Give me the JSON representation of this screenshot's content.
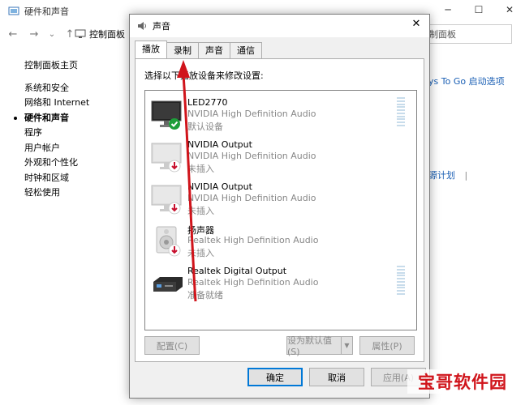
{
  "bg_window": {
    "title": "硬件和声音",
    "controls": [
      "─",
      "☐",
      "✕"
    ],
    "nav": {
      "back": "←",
      "forward": "→",
      "dropdown": "⌄",
      "up": "↑",
      "address": "控制面板",
      "search_placeholder": "控制面板"
    },
    "sidebar": [
      "控制面板主页",
      "系统和安全",
      "网络和 Internet",
      "硬件和声音",
      "程序",
      "用户帐户",
      "外观和个性化",
      "时钟和区域",
      "轻松使用"
    ],
    "right_link1": "ys To Go  启动选项",
    "right_link2": "源计划",
    "right_sep": "|"
  },
  "dialog": {
    "title": "声音",
    "close": "✕",
    "tabs": [
      "播放",
      "录制",
      "声音",
      "通信"
    ],
    "instruction": "选择以下播放设备来修改设置:",
    "devices": [
      {
        "name": "LED2770",
        "driver": "NVIDIA High Definition Audio",
        "status": "默认设备",
        "icon": "monitor-default-icon"
      },
      {
        "name": "NVIDIA Output",
        "driver": "NVIDIA High Definition Audio",
        "status": "未插入",
        "icon": "monitor-unplugged-icon"
      },
      {
        "name": "NVIDIA Output",
        "driver": "NVIDIA High Definition Audio",
        "status": "未插入",
        "icon": "monitor-unplugged-icon"
      },
      {
        "name": "扬声器",
        "driver": "Realtek High Definition Audio",
        "status": "未插入",
        "icon": "speaker-unplugged-icon"
      },
      {
        "name": "Realtek Digital Output",
        "driver": "Realtek High Definition Audio",
        "status": "准备就绪",
        "icon": "digital-output-icon"
      }
    ],
    "buttons": {
      "configure": "配置(C)",
      "set_default": "设为默认值(S)",
      "properties": "属性(P)",
      "ok": "确定",
      "cancel": "取消",
      "apply": "应用(A)"
    }
  },
  "watermark": "宝哥软件园",
  "colors": {
    "accent": "#0078d7",
    "link": "#1a5fb4",
    "arrow": "#d0141b",
    "check": "#1e9e3a",
    "unplug": "#c8102e"
  }
}
